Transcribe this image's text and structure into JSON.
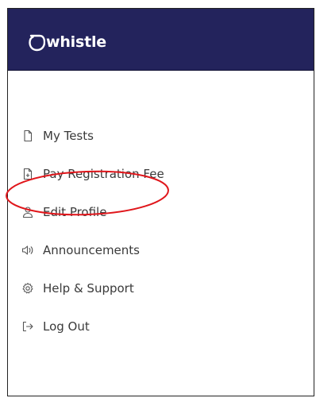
{
  "brand": {
    "name": "whistle",
    "bar_color": "#23235c"
  },
  "menu": {
    "items": [
      {
        "label": "My Tests",
        "icon": "document-icon"
      },
      {
        "label": "Pay Registration Fee",
        "icon": "document-add-icon"
      },
      {
        "label": "Edit Profile",
        "icon": "user-icon"
      },
      {
        "label": "Announcements",
        "icon": "speaker-icon"
      },
      {
        "label": "Help & Support",
        "icon": "gear-icon"
      },
      {
        "label": "Log Out",
        "icon": "logout-icon"
      }
    ]
  },
  "annotation": {
    "highlighted_item": "Edit Profile",
    "color": "#e0161b"
  }
}
